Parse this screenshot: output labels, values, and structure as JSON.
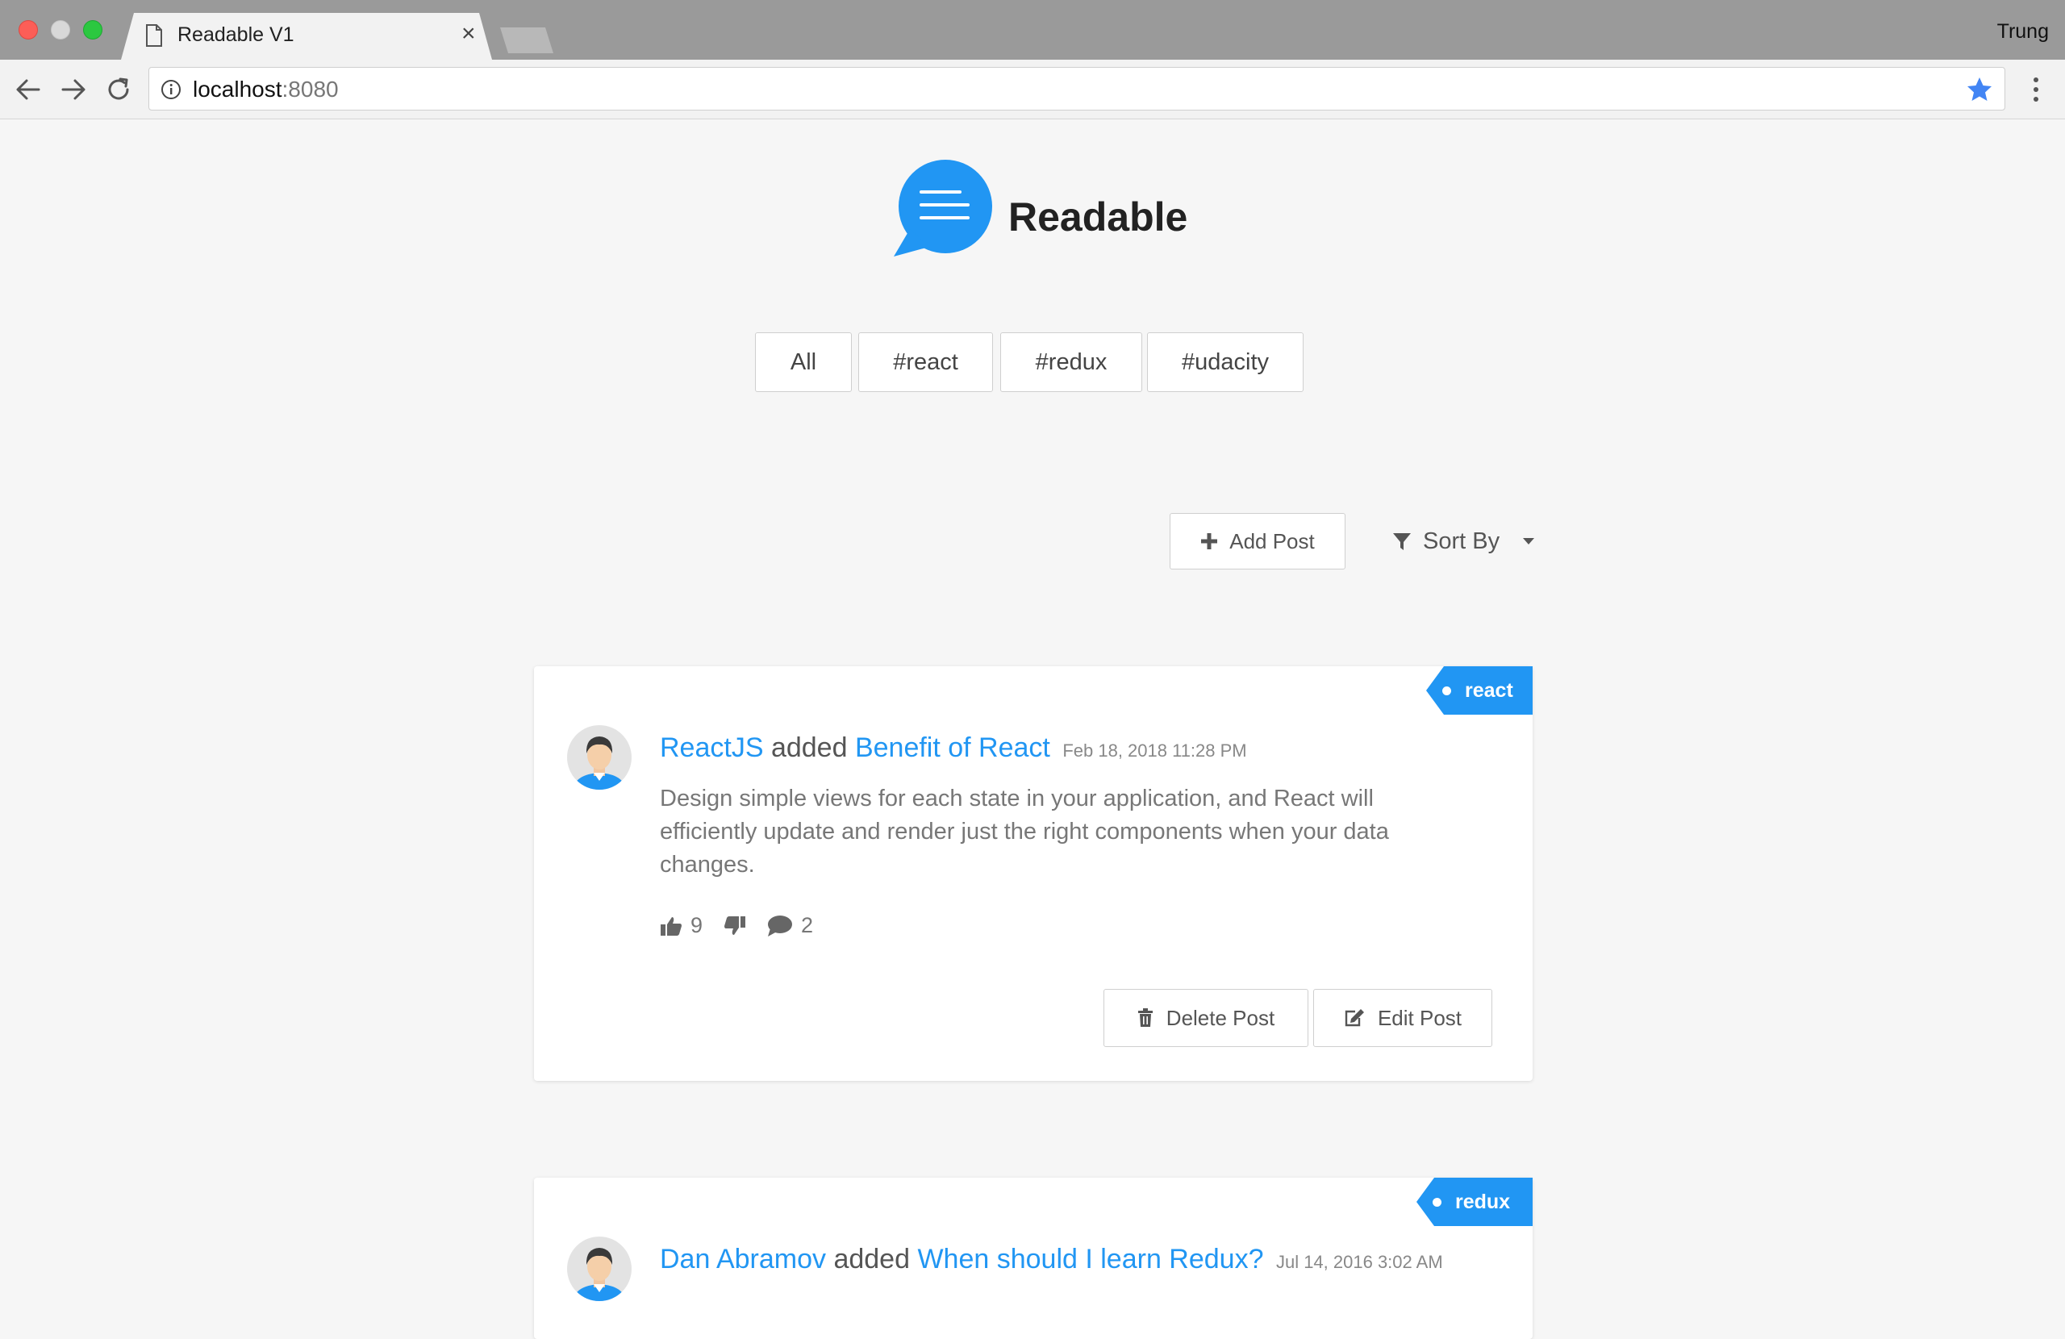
{
  "browser": {
    "tab_title": "Readable V1",
    "tab_close": "×",
    "profile_name": "Trung",
    "url_host": "localhost",
    "url_port": ":8080",
    "star_color": "#4285f4"
  },
  "brand": {
    "name": "Readable",
    "logo_color": "#2196f3"
  },
  "categories": [
    {
      "label": "All"
    },
    {
      "label": "#react"
    },
    {
      "label": "#redux"
    },
    {
      "label": "#udacity"
    }
  ],
  "actions": {
    "add_post_label": "Add Post",
    "sort_by_label": "Sort By"
  },
  "posts": [
    {
      "category": "react",
      "author": "ReactJS",
      "verb": "added",
      "title": "Benefit of React",
      "date": "Feb 18, 2018 11:28 PM",
      "body": "Design simple views for each state in your application, and React will efficiently update and render just the right components when your data changes.",
      "upvotes": "9",
      "comments": "2",
      "delete_label": "Delete Post",
      "edit_label": "Edit Post"
    },
    {
      "category": "redux",
      "author": "Dan Abramov",
      "verb": "added",
      "title": "When should I learn Redux?",
      "date": "Jul 14, 2016 3:02 AM"
    }
  ],
  "colors": {
    "accent": "#2196f3",
    "page_bg": "#f6f6f6"
  }
}
